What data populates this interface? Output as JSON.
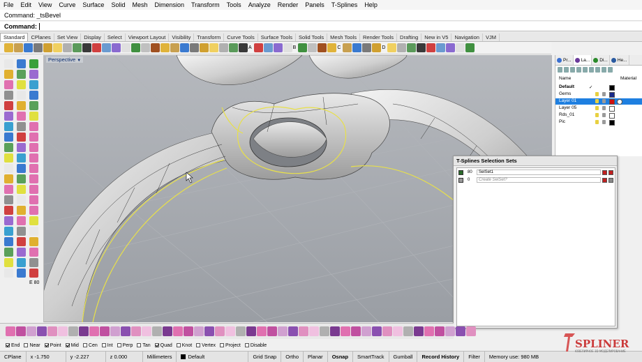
{
  "menu": [
    "File",
    "Edit",
    "View",
    "Curve",
    "Surface",
    "Solid",
    "Mesh",
    "Dimension",
    "Transform",
    "Tools",
    "Analyze",
    "Render",
    "Panels",
    "T-Splines",
    "Help"
  ],
  "command_history": "Command: _tsBevel",
  "command_prompt": "Command:",
  "tabs": [
    "Standard",
    "CPlanes",
    "Set View",
    "Display",
    "Select",
    "Viewport Layout",
    "Visibility",
    "Transform",
    "Curve Tools",
    "Surface Tools",
    "Solid Tools",
    "Mesh Tools",
    "Render Tools",
    "Drafting",
    "New in V5",
    "Navigation",
    "VJM"
  ],
  "toolbar_letters": [
    "A",
    "B",
    "C",
    "D"
  ],
  "viewport": {
    "label": "Perspective",
    "label_arrow": "▼"
  },
  "left_counter": "E 80",
  "right_panel": {
    "tabs": [
      {
        "label": "Pr...",
        "icon": "properties-icon",
        "color": "#3a6fd0"
      },
      {
        "label": "La...",
        "icon": "layers-icon",
        "color": "#6a3a9a"
      },
      {
        "label": "Di...",
        "icon": "display-icon",
        "color": "#2a8a2a"
      },
      {
        "label": "He...",
        "icon": "help-icon",
        "color": "#2a5aa0"
      }
    ],
    "columns": {
      "name": "Name",
      "material": "Material"
    },
    "layers": [
      {
        "name": "Default",
        "current": true,
        "check": "✓",
        "color": "#000000",
        "selected": false,
        "bold": true
      },
      {
        "name": "Gems",
        "current": false,
        "check": "",
        "color": "#1a2a8a",
        "selected": false,
        "bold": false
      },
      {
        "name": "Layer 01",
        "current": false,
        "check": "",
        "color": "#d01010",
        "selected": true,
        "bold": false
      },
      {
        "name": "Layer 05",
        "current": false,
        "check": "",
        "color": "#ffffff",
        "selected": false,
        "bold": false
      },
      {
        "name": "Rds_01",
        "current": false,
        "check": "",
        "color": "#ffffff",
        "selected": false,
        "bold": false
      },
      {
        "name": "Pic",
        "current": false,
        "check": "",
        "color": "#000000",
        "selected": false,
        "bold": false
      }
    ]
  },
  "selection_sets": {
    "title": "T-Splines Selection Sets",
    "rows": [
      {
        "count": "80",
        "name": "SelSet1",
        "placeholder": false
      },
      {
        "count": "0",
        "name": "Create SelSet?",
        "placeholder": true
      }
    ]
  },
  "osnap": [
    {
      "label": "End",
      "on": true
    },
    {
      "label": "Near",
      "on": false
    },
    {
      "label": "Point",
      "on": true
    },
    {
      "label": "Mid",
      "on": true
    },
    {
      "label": "Cen",
      "on": false
    },
    {
      "label": "Int",
      "on": false
    },
    {
      "label": "Perp",
      "on": false
    },
    {
      "label": "Tan",
      "on": false
    },
    {
      "label": "Quad",
      "on": true
    },
    {
      "label": "Knot",
      "on": false
    },
    {
      "label": "Vertex",
      "on": false
    },
    {
      "label": "Project",
      "on": false
    },
    {
      "label": "Disable",
      "on": false
    }
  ],
  "status": {
    "cplane": "CPlane",
    "x": "x -1.750",
    "y": "y -2.227",
    "z": "z 0.000",
    "units": "Millimeters",
    "layer": "Default",
    "layer_color": "#000000",
    "toggles": [
      {
        "label": "Grid Snap",
        "bold": false
      },
      {
        "label": "Ortho",
        "bold": false
      },
      {
        "label": "Planar",
        "bold": false
      },
      {
        "label": "Osnap",
        "bold": true
      },
      {
        "label": "SmartTrack",
        "bold": false
      },
      {
        "label": "Gumball",
        "bold": false
      },
      {
        "label": "Record History",
        "bold": true
      },
      {
        "label": "Filter",
        "bold": false
      }
    ],
    "memory": "Memory use: 980 MB"
  },
  "watermark": {
    "text": "SPLINER",
    "sub": "ЮВЕЛИРНОЕ 3D МОДЕЛИРОВАНИЕ"
  },
  "colors": {
    "selection_curve": "#e8e04a",
    "viewport_bg": "#a3a7ad",
    "selected_row": "#1e7fe0"
  }
}
